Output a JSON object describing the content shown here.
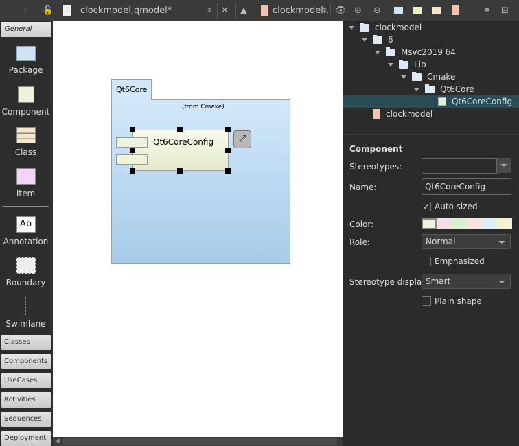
{
  "toolbar": {
    "file_name": "clockmodel.qmodel*",
    "model_name": "clockmodel..."
  },
  "palette": {
    "header": "General",
    "items": [
      {
        "label": "Package"
      },
      {
        "label": "Component"
      },
      {
        "label": "Class"
      },
      {
        "label": "Item"
      },
      {
        "label": "Annotation",
        "icon_text": "Ab"
      },
      {
        "label": "Boundary"
      },
      {
        "label": "Swimlane"
      }
    ],
    "tabs": [
      "Classes",
      "Components",
      "UseCases",
      "Activities",
      "Sequences",
      "Deployment"
    ]
  },
  "diagram": {
    "package_name": "Qt6Core",
    "package_from": "(from Cmake)",
    "component_name": "Qt6CoreConfig"
  },
  "tree": [
    {
      "label": "clockmodel",
      "level": 0,
      "type": "folder"
    },
    {
      "label": "6",
      "level": 1,
      "type": "folder"
    },
    {
      "label": "Msvc2019 64",
      "level": 2,
      "type": "folder"
    },
    {
      "label": "Lib",
      "level": 3,
      "type": "folder"
    },
    {
      "label": "Cmake",
      "level": 4,
      "type": "folder"
    },
    {
      "label": "Qt6Core",
      "level": 5,
      "type": "folder"
    },
    {
      "label": "Qt6CoreConfig",
      "level": 6,
      "type": "component",
      "selected": true
    },
    {
      "label": "clockmodel",
      "level": 1,
      "type": "diagram"
    }
  ],
  "properties": {
    "title": "Component",
    "stereotypes_label": "Stereotypes:",
    "stereotypes_value": "",
    "name_label": "Name:",
    "name_value": "Qt6CoreConfig",
    "auto_sized_label": "Auto sized",
    "auto_sized": true,
    "color_label": "Color:",
    "colors": [
      "#eef2e0",
      "#f6dde6",
      "#d9f0cc",
      "#f6e4dc",
      "#ddeef4",
      "#f6f0d4"
    ],
    "role_label": "Role:",
    "role_value": "Normal",
    "emphasized_label": "Emphasized",
    "emphasized": false,
    "stereotype_display_label": "Stereotype display:",
    "stereotype_display_value": "Smart",
    "plain_shape_label": "Plain shape",
    "plain_shape": false
  }
}
